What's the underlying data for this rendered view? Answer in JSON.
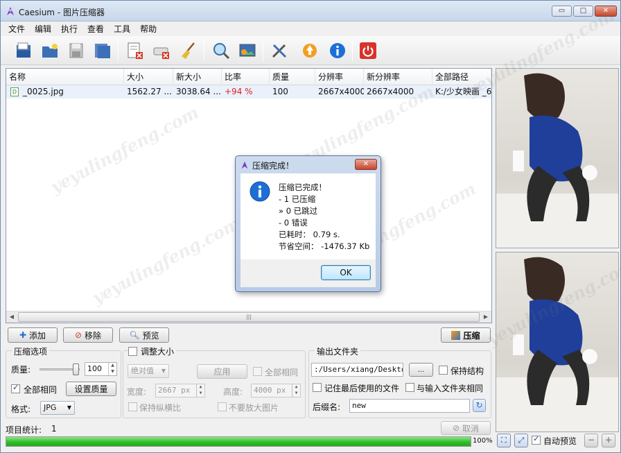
{
  "window": {
    "title": "Caesium - 图片压缩器",
    "min": "▭",
    "max": "□",
    "close": "✕"
  },
  "menu": [
    "文件",
    "编辑",
    "执行",
    "查看",
    "工具",
    "帮助"
  ],
  "toolbar_icons": [
    "open-file-icon",
    "open-folder-icon",
    "save-icon",
    "save-all-icon",
    "remove-item-icon",
    "clear-list-icon",
    "broom-icon",
    "preview-zoom-icon",
    "image-preview-icon",
    "settings-tools-icon",
    "update-icon",
    "info-icon",
    "power-exit-icon"
  ],
  "list": {
    "headers": [
      "名称",
      "大小",
      "新大小",
      "比率",
      "质量",
      "分辨率",
      "新分辨率",
      "全部路径"
    ],
    "rows": [
      {
        "icon": "D",
        "name": "_0025.jpg",
        "size": "1562.27 ...",
        "new_size": "3038.64 ...",
        "ratio": "+94 %",
        "quality": "100",
        "resolution": "2667x4000",
        "new_resolution": "2667x4000",
        "path": "K:/少女映画 _6"
      }
    ],
    "scroll_grip": "|||"
  },
  "buttons": {
    "add": "添加",
    "remove": "移除",
    "preview": "预览",
    "compress": "压缩"
  },
  "compression": {
    "group_label": "压缩选项",
    "quality_label": "质量:",
    "quality_value": "100",
    "quality_slider_level": 1.0,
    "same_all_label": "全部相同",
    "set_quality_label": "设置质量",
    "format_label": "格式:",
    "format_value": "JPG"
  },
  "resize": {
    "group_label": "调整大小",
    "mode": "绝对值",
    "apply": "应用",
    "same_all": "全部相同",
    "width_label": "宽度:",
    "width_value": "2667 px",
    "height_label": "高度:",
    "height_value": "4000 px",
    "keep_ratio": "保持纵横比",
    "no_enlarge": "不要放大图片"
  },
  "output": {
    "group_label": "输出文件夹",
    "path": ":/Users/xiang/Desktop",
    "browse": "...",
    "keep_structure": "保持结构",
    "remember_last": "记住最后使用的文件",
    "same_as_input": "与输入文件夹相同",
    "suffix_label": "后缀名:",
    "suffix_value": "new"
  },
  "status": {
    "items_label": "项目统计:",
    "items_count": "1",
    "cancel": "取消",
    "progress_text": "100%",
    "progress": 1.0
  },
  "preview_panel": {
    "auto_preview": "自动预览"
  },
  "dialog": {
    "title": "压缩完成！",
    "lines": [
      "压缩已完成！",
      "- 1 已压缩",
      "» 0 已跳过",
      "- 0 错误",
      "已耗时： 0.79 s.",
      "节省空间： -1476.37 Kb"
    ],
    "ok": "OK"
  },
  "watermark": "yeyulingfeng.com",
  "colors": {
    "ratio_positive": "#e02020",
    "progress": "#2fbf2a",
    "selection": "#eaf1fb"
  }
}
